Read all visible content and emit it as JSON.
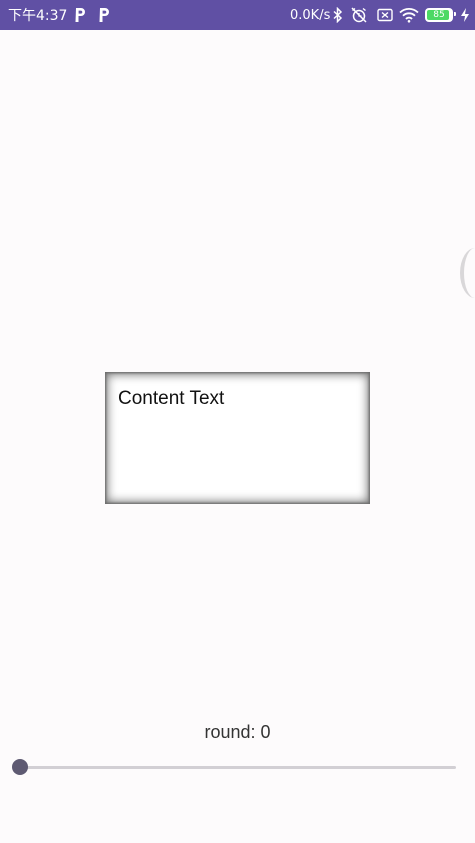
{
  "status_bar": {
    "time": "下午4:37",
    "notification_icons": [
      "parking-app-icon",
      "parking-app-icon"
    ],
    "net_speed": "0.0K/s",
    "icons": [
      "bluetooth-icon",
      "alarm-off-icon",
      "no-sim-icon",
      "wifi-icon",
      "battery-icon",
      "charging-icon"
    ],
    "battery_level": "85",
    "background_color": "#6050a4"
  },
  "content": {
    "card_text": "Content Text"
  },
  "round_control": {
    "label": "round: 0",
    "slider_value": 0,
    "thumb_color": "#5e5a72",
    "track_color": "#d2cfd4"
  }
}
